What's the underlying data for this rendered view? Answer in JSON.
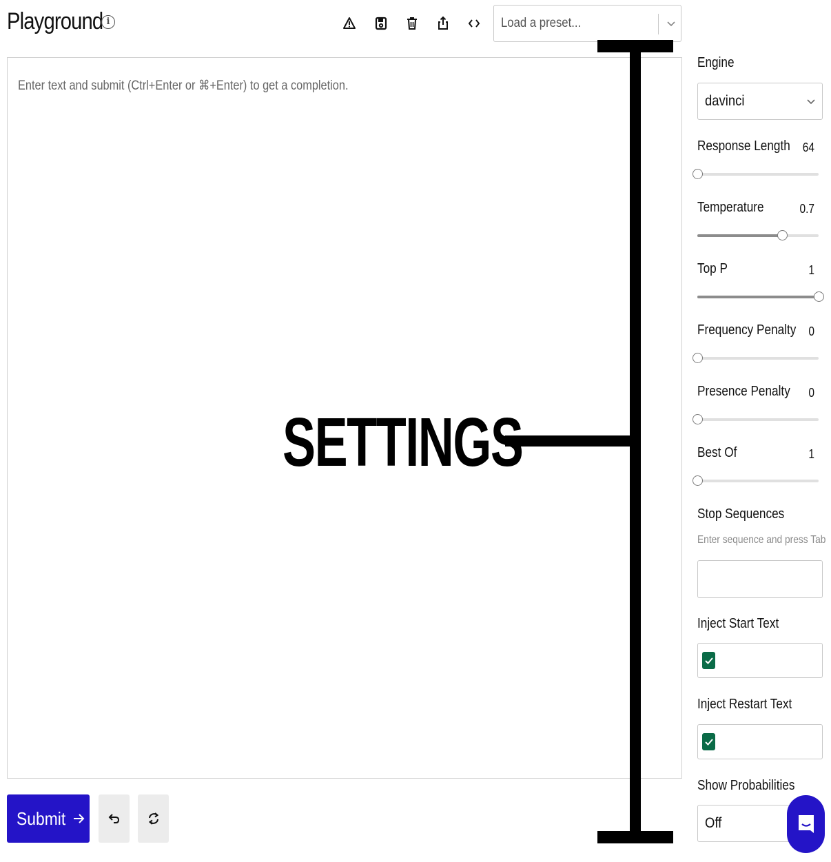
{
  "header": {
    "title": "Playground",
    "info_icon": "info-icon",
    "toolbar_icons": [
      "warning-icon",
      "save-icon",
      "trash-icon",
      "share-icon",
      "code-icon"
    ],
    "preset_placeholder": "Load a preset..."
  },
  "editor": {
    "placeholder": "Enter text and submit (Ctrl+Enter or ⌘+Enter) to get a completion."
  },
  "actions": {
    "submit_label": "Submit",
    "undo_icon": "undo-icon",
    "regenerate_icon": "regenerate-icon"
  },
  "annotation": {
    "label": "SETTINGS",
    "color": "#000000"
  },
  "sidebar": {
    "engine_label": "Engine",
    "engine_value": "davinci",
    "sliders": [
      {
        "label": "Response Length",
        "value": "64",
        "fill_fraction": 0.0
      },
      {
        "label": "Temperature",
        "value": "0.7",
        "fill_fraction": 0.7
      },
      {
        "label": "Top P",
        "value": "1",
        "fill_fraction": 1.0
      },
      {
        "label": "Frequency Penalty",
        "value": "0",
        "fill_fraction": 0.0
      },
      {
        "label": "Presence Penalty",
        "value": "0",
        "fill_fraction": 0.0
      },
      {
        "label": "Best Of",
        "value": "1",
        "fill_fraction": 0.0
      }
    ],
    "stop_sequences_label": "Stop Sequences",
    "stop_sequences_hint": "Enter sequence and press Tab",
    "inject_start_label": "Inject Start Text",
    "inject_start_checked": true,
    "inject_restart_label": "Inject Restart Text",
    "inject_restart_checked": true,
    "show_probabilities_label": "Show Probabilities",
    "show_probabilities_value": "Off"
  },
  "colors": {
    "accent": "#2414c7",
    "checkbox": "#0a6b47",
    "slider_fill": "#8c8c8c"
  }
}
